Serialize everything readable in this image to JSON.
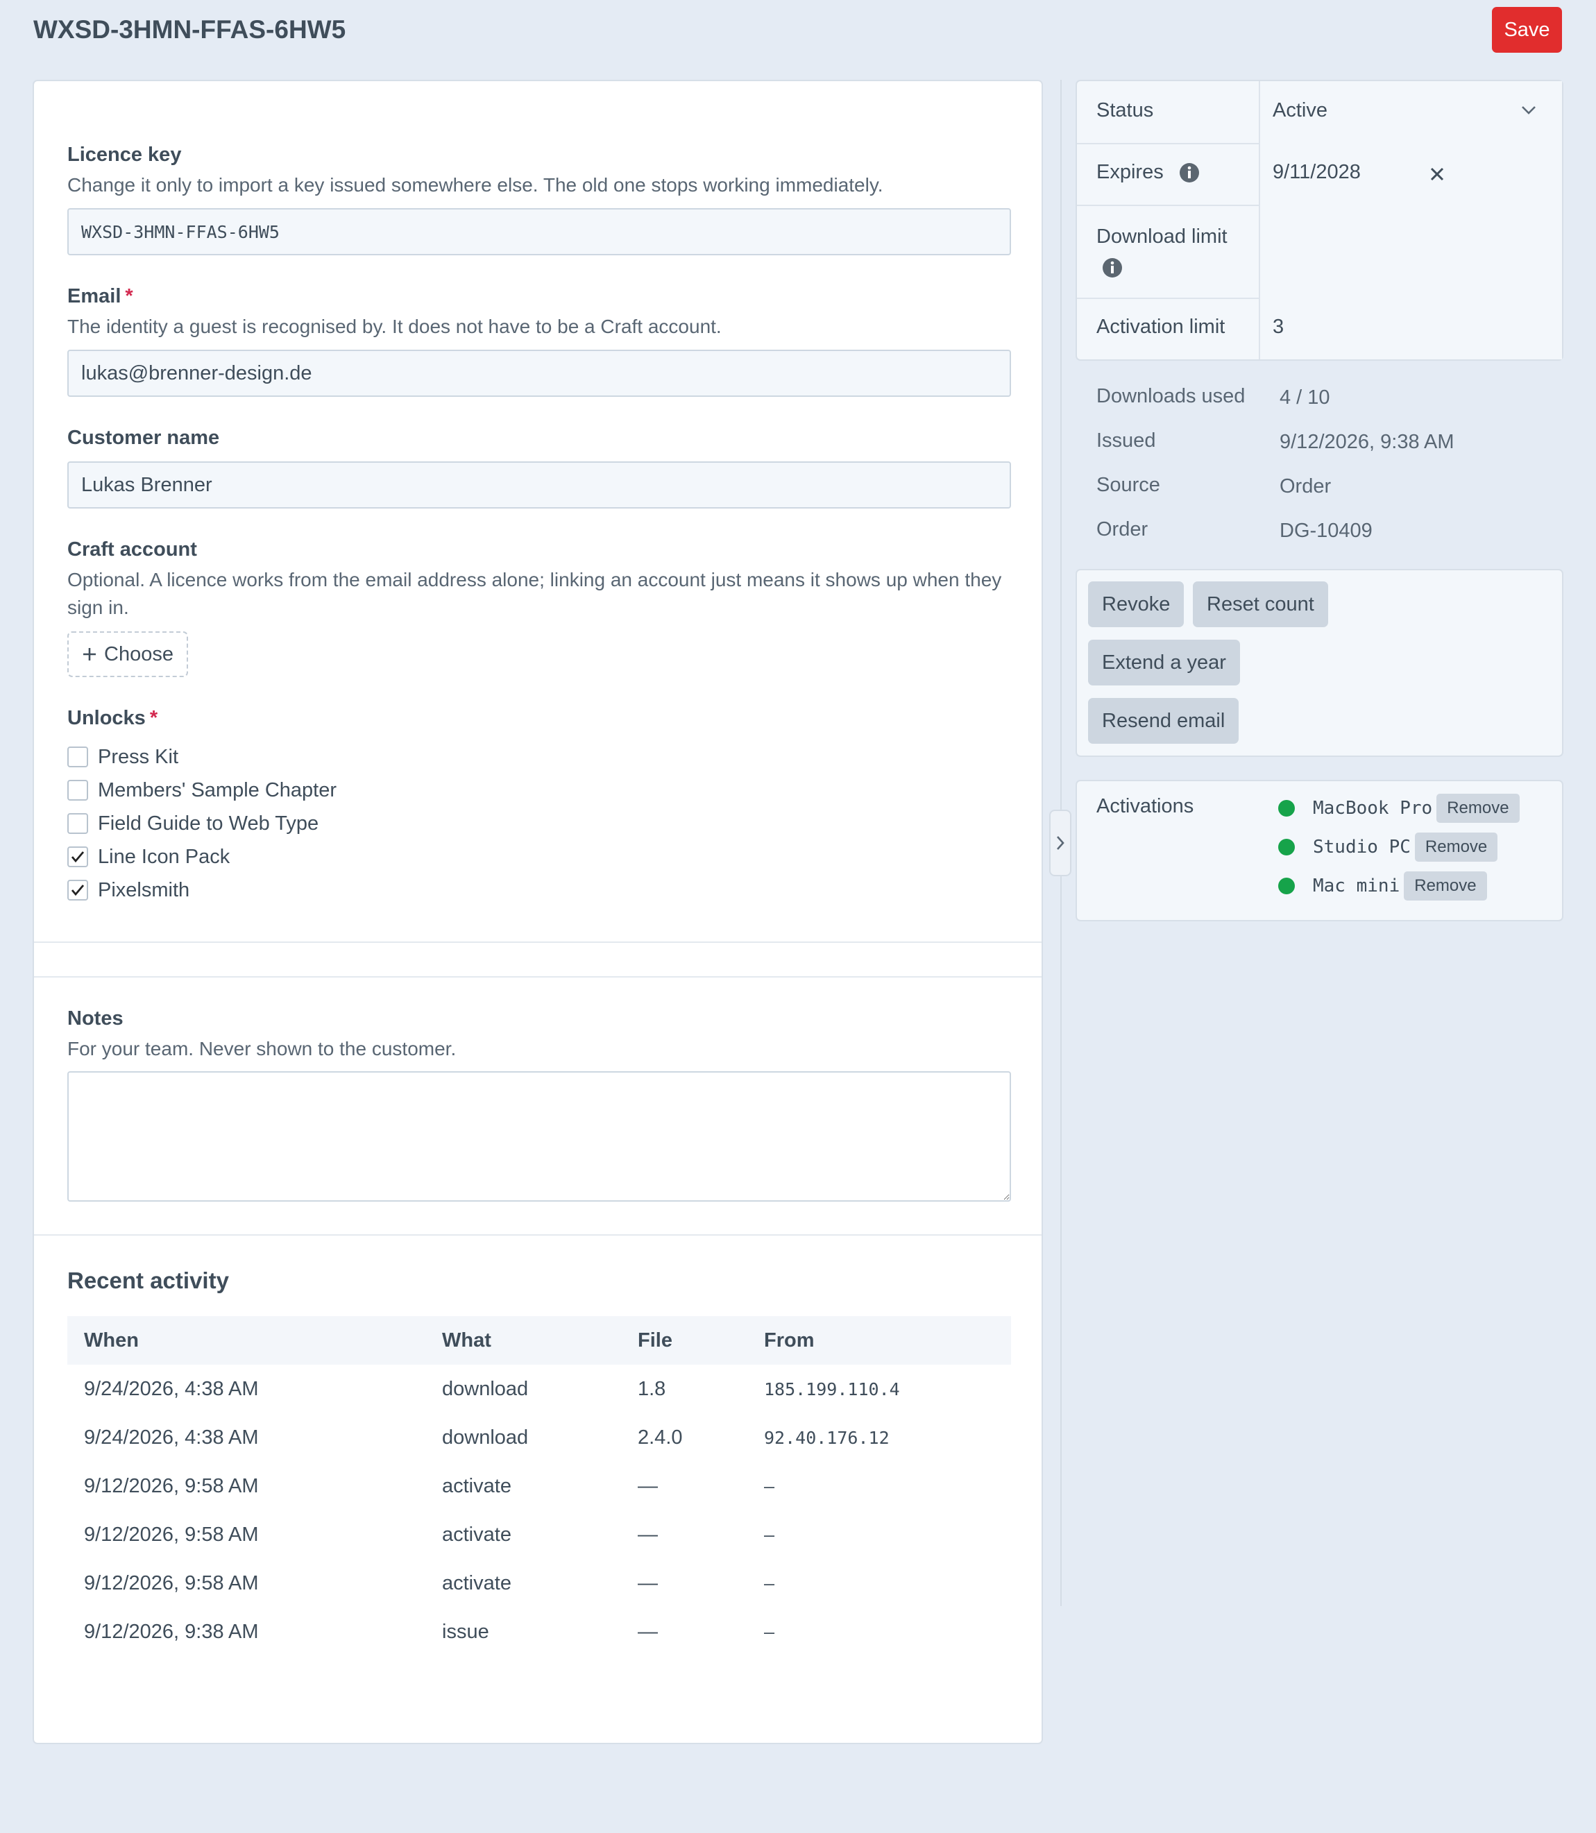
{
  "header": {
    "title": "WXSD-3HMN-FFAS-6HW5",
    "save_label": "Save"
  },
  "form": {
    "licence_key": {
      "label": "Licence key",
      "hint": "Change it only to import a key issued somewhere else. The old one stops working immediately.",
      "value": "WXSD-3HMN-FFAS-6HW5"
    },
    "email": {
      "label": "Email",
      "required_mark": "*",
      "hint": "The identity a guest is recognised by. It does not have to be a Craft account.",
      "value": "lukas@brenner-design.de"
    },
    "customer_name": {
      "label": "Customer name",
      "value": "Lukas Brenner"
    },
    "craft_account": {
      "label": "Craft account",
      "hint": "Optional. A licence works from the email address alone; linking an account just means it shows up when they sign in.",
      "choose_label": "Choose",
      "choose_icon": "plus-icon"
    },
    "unlocks": {
      "label": "Unlocks",
      "required_mark": "*",
      "items": [
        {
          "label": "Press Kit",
          "checked": false
        },
        {
          "label": "Members' Sample Chapter",
          "checked": false
        },
        {
          "label": "Field Guide to Web Type",
          "checked": false
        },
        {
          "label": "Line Icon Pack",
          "checked": true
        },
        {
          "label": "Pixelsmith",
          "checked": true
        }
      ]
    },
    "notes": {
      "label": "Notes",
      "hint": "For your team. Never shown to the customer.",
      "value": ""
    }
  },
  "activity": {
    "heading": "Recent activity",
    "columns": [
      "When",
      "What",
      "File",
      "From"
    ],
    "rows": [
      [
        "9/24/2026, 4:38 AM",
        "download",
        "1.8",
        "185.199.110.4"
      ],
      [
        "9/24/2026, 4:38 AM",
        "download",
        "2.4.0",
        "92.40.176.12"
      ],
      [
        "9/12/2026, 9:58 AM",
        "activate",
        "—",
        "–"
      ],
      [
        "9/12/2026, 9:58 AM",
        "activate",
        "—",
        "–"
      ],
      [
        "9/12/2026, 9:58 AM",
        "activate",
        "—",
        "–"
      ],
      [
        "9/12/2026, 9:38 AM",
        "issue",
        "—",
        "–"
      ]
    ]
  },
  "meta": {
    "status_label": "Status",
    "status_value": "Active",
    "expires_label": "Expires",
    "expires_value": "9/11/2028",
    "download_limit_label": "Download limit",
    "download_limit_value": "",
    "activation_limit_label": "Activation limit",
    "activation_limit_value": "3"
  },
  "stats": [
    {
      "label": "Downloads used",
      "value": "4 / 10"
    },
    {
      "label": "Issued",
      "value": "9/12/2026, 9:38 AM"
    },
    {
      "label": "Source",
      "value": "Order"
    },
    {
      "label": "Order",
      "value": "DG-10409"
    }
  ],
  "actions": {
    "revoke": "Revoke",
    "reset_count": "Reset count",
    "extend": "Extend a year",
    "resend": "Resend email"
  },
  "activations": {
    "label": "Activations",
    "remove_label": "Remove",
    "status_color": "#16a34a",
    "devices": [
      "MacBook Pro",
      "Studio PC",
      "Mac mini"
    ]
  },
  "colors": {
    "accent": "#e12d2d",
    "background": "#e4ebf4",
    "required": "#d3294f"
  }
}
